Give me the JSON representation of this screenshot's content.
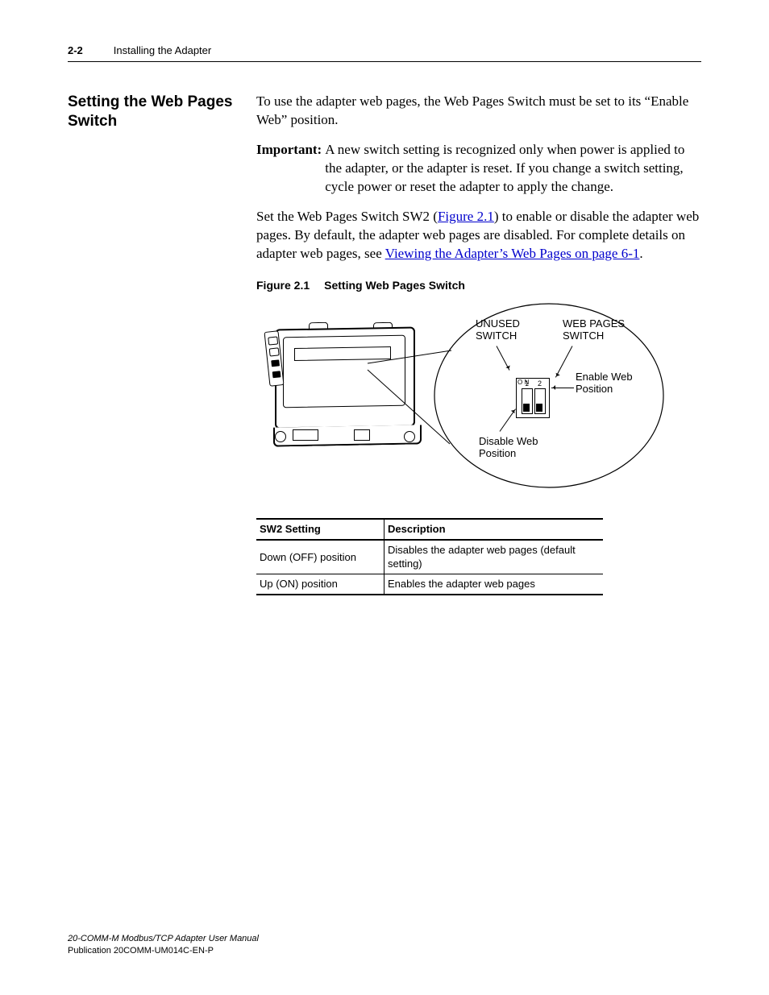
{
  "header": {
    "page_number": "2-2",
    "chapter_title": "Installing the Adapter"
  },
  "section": {
    "title": "Setting the Web Pages Switch",
    "intro": "To use the adapter web pages, the Web Pages Switch must be set to its “Enable Web” position.",
    "important_label": "Important:",
    "important_text": "A new switch setting is recognized only when power is applied to the adapter, or the adapter is reset. If you change a switch setting, cycle power or reset the adapter to apply the change.",
    "para2_pre": "Set the Web Pages Switch SW2 (",
    "para2_link1": "Figure 2.1",
    "para2_mid": ") to enable or disable the adapter web pages. By default, the adapter web pages are disabled. For complete details on adapter web pages, see ",
    "para2_link2": "Viewing the Adapter’s Web Pages on page 6-1",
    "para2_post": "."
  },
  "figure": {
    "number": "Figure 2.1",
    "title": "Setting Web Pages Switch",
    "labels": {
      "unused_switch_l1": "UNUSED",
      "unused_switch_l2": "SWITCH",
      "web_pages_switch_l1": "WEB PAGES",
      "web_pages_switch_l2": "SWITCH",
      "enable_l1": "Enable Web",
      "enable_l2": "Position",
      "disable_l1": "Disable Web",
      "disable_l2": "Position",
      "sw_on": "O\nN",
      "sw_1": "1",
      "sw_2": "2"
    }
  },
  "table": {
    "headers": [
      "SW2 Setting",
      "Description"
    ],
    "rows": [
      [
        "Down (OFF) position",
        "Disables the adapter web pages (default setting)"
      ],
      [
        "Up (ON) position",
        "Enables the adapter web pages"
      ]
    ]
  },
  "footer": {
    "manual_title": "20-COMM-M Modbus/TCP Adapter User Manual",
    "publication": "Publication 20COMM-UM014C-EN-P"
  }
}
